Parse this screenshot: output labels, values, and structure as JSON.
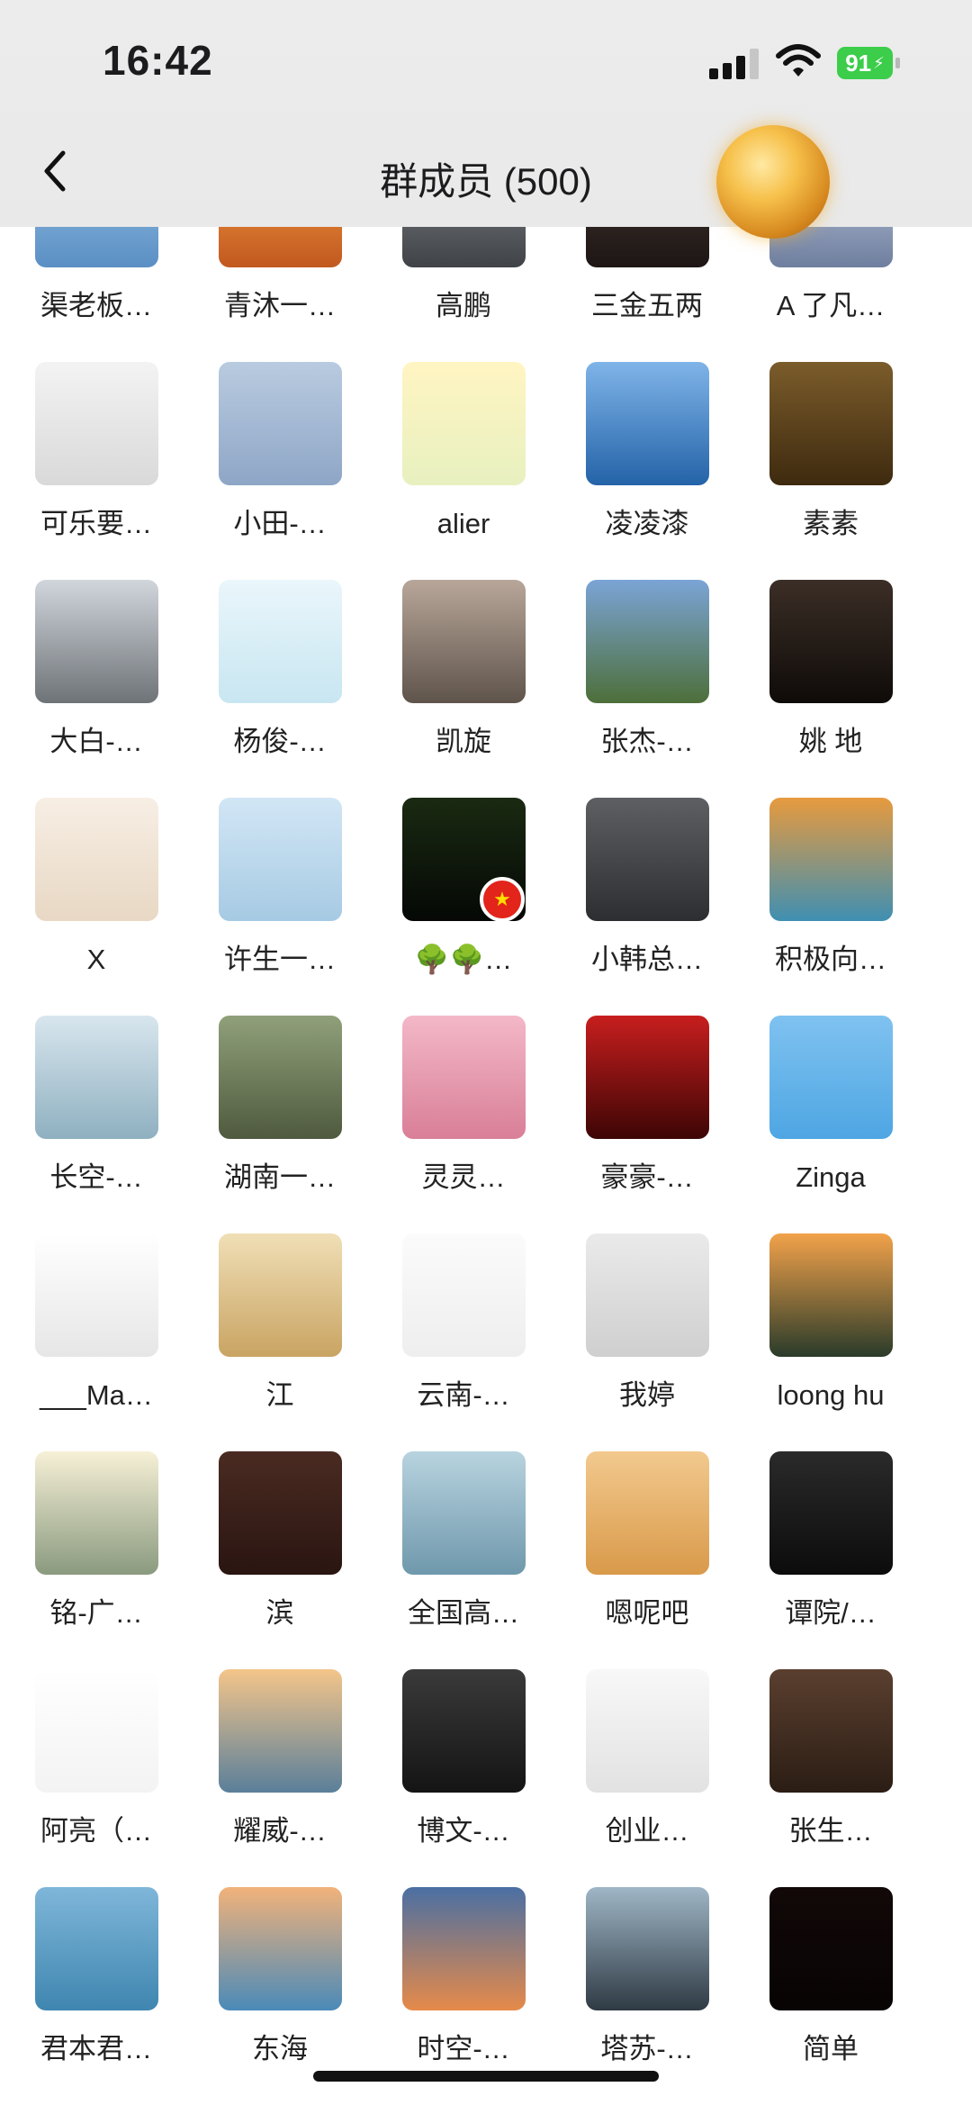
{
  "status_bar": {
    "time": "16:42",
    "battery": "91"
  },
  "header": {
    "title": "群成员 (500)"
  },
  "members": [
    {
      "name": "渠老板…",
      "bg": "linear-gradient(#9fc7e8,#5a8fc4)",
      "icon": "red-heart-icon"
    },
    {
      "name": "青沐一…",
      "bg": "linear-gradient(#f8a94a,#c2581f)",
      "icon": "sunset-person-icon"
    },
    {
      "name": "高鹏",
      "bg": "linear-gradient(#8a8d92,#3f4247)",
      "icon": "landscape-icon"
    },
    {
      "name": "三金五两",
      "bg": "linear-gradient(#4a3a33,#1d1614)",
      "icon": "person-photo-icon"
    },
    {
      "name": "A 了凡…",
      "bg": "linear-gradient(#c9d3e6,#6e7e9e)",
      "icon": "snow-scene-icon"
    },
    {
      "name": "可乐要…",
      "bg": "linear-gradient(#f3f3f3,#d9d9d9)",
      "icon": "man-photo-icon"
    },
    {
      "name": "小田-…",
      "bg": "linear-gradient(#b9cbe0,#8ea6c6)",
      "icon": "cartoon-boy-icon"
    },
    {
      "name": "alier",
      "bg": "linear-gradient(#fff5c2,#e8f0c0)",
      "icon": "cartoon-penguin-icon"
    },
    {
      "name": "凌凌漆",
      "bg": "linear-gradient(#7fb4e8,#2463a8)",
      "icon": "sailboat-icon"
    },
    {
      "name": "素素",
      "bg": "linear-gradient(#7b5c2b,#3e2a0f)",
      "icon": "golden-rose-icon"
    },
    {
      "name": "大白-…",
      "bg": "linear-gradient(#d1d6dc,#6e7378)",
      "icon": "sports-car-icon"
    },
    {
      "name": "杨俊-…",
      "bg": "linear-gradient(#eaf6fb,#c8e6f1)",
      "icon": "cartoon-bear-icon"
    },
    {
      "name": "凯旋",
      "bg": "linear-gradient(#b8a699,#5f544b)",
      "icon": "rock-person-icon"
    },
    {
      "name": "张杰-…",
      "bg": "linear-gradient(#7ba4d6,#4d6f3a)",
      "icon": "waterfall-icon"
    },
    {
      "name": "姚 地",
      "bg": "linear-gradient(#3b2e26,#0f0b09)",
      "icon": "smiling-man-icon"
    },
    {
      "name": "X",
      "bg": "linear-gradient(#f7eee4,#e8d8c4)",
      "icon": "anime-boy-icon"
    },
    {
      "name": "许生一…",
      "bg": "linear-gradient(#d2e6f5,#a6cae3)",
      "icon": "purple-flower-icon"
    },
    {
      "name": "🌳🌳…",
      "bg": "linear-gradient(#1a2a12,#050805)",
      "icon": "night-lake-icon",
      "badge": "china-flag-icon"
    },
    {
      "name": "小韩总…",
      "bg": "linear-gradient(#5d5f63,#2c2e31)",
      "icon": "businessman-icon"
    },
    {
      "name": "积极向…",
      "bg": "linear-gradient(#e79a3e,#3f8fb2)",
      "icon": "autumn-tree-icon"
    },
    {
      "name": "长空-…",
      "bg": "linear-gradient(#d8e6ee,#8fb0c0)",
      "icon": "lake-person-icon"
    },
    {
      "name": "湖南一…",
      "bg": "linear-gradient(#90a07a,#4f5a3e)",
      "icon": "family-photo-icon"
    },
    {
      "name": "灵灵…",
      "bg": "linear-gradient(#f3b8c8,#d97f97)",
      "icon": "anime-girl-icon"
    },
    {
      "name": "豪豪-…",
      "bg": "linear-gradient(#c81e1e,#3d0505)",
      "icon": "black-horse-icon"
    },
    {
      "name": "Zinga",
      "bg": "linear-gradient(#7fc2f0,#4ea6e3)",
      "icon": "cartoon-suit-man-icon"
    },
    {
      "name": "___Ma…",
      "bg": "linear-gradient(#ffffff,#e6e6e6)",
      "icon": "suit-silhouette-icon"
    },
    {
      "name": "江",
      "bg": "linear-gradient(#f0dfb6,#c9a463)",
      "icon": "guardian-gods-icon"
    },
    {
      "name": "云南-…",
      "bg": "linear-gradient(#fbfbfb,#eeeeee)",
      "icon": "fashion-boy-icon"
    },
    {
      "name": "我婷",
      "bg": "linear-gradient(#eaeaea,#cfcfcf)",
      "icon": "cassette-head-icon"
    },
    {
      "name": "loong hu",
      "bg": "linear-gradient(#f2a24a,#2a3b2a)",
      "icon": "sunset-tree-icon"
    },
    {
      "name": "铭-广…",
      "bg": "linear-gradient(#f6f0d6,#8a9a7f)",
      "icon": "sunglasses-buddha-icon"
    },
    {
      "name": "滨",
      "bg": "linear-gradient(#4a2b22,#2a1511)",
      "icon": "illustrated-man-icon"
    },
    {
      "name": "全国高…",
      "bg": "linear-gradient(#b8d3df,#6f98ac)",
      "icon": "beach-person-icon"
    },
    {
      "name": "嗯呢吧",
      "bg": "linear-gradient(#f2c98e,#d99a4a)",
      "icon": "panda-bird-icon"
    },
    {
      "name": "谭院/…",
      "bg": "linear-gradient(#2a2a2a,#0c0c0c)",
      "icon": "car-window-icon"
    },
    {
      "name": "阿亮（…",
      "bg": "linear-gradient(#ffffff,#f3f3f3)",
      "icon": "sketch-boy-logo-icon"
    },
    {
      "name": "耀威-…",
      "bg": "linear-gradient(#f4c58a,#5a7f9a)",
      "icon": "mountain-hiker-icon"
    },
    {
      "name": "博文-…",
      "bg": "linear-gradient(#3a3a3a,#141414)",
      "icon": "motorcycle-icon"
    },
    {
      "name": "创业…",
      "bg": "linear-gradient(#f8f8f8,#e2e2e2)",
      "icon": "laptop-man-icon"
    },
    {
      "name": "张生…",
      "bg": "linear-gradient(#5a3f2f,#2b1d14)",
      "icon": "furniture-logo-icon"
    },
    {
      "name": "君本君…",
      "bg": "linear-gradient(#7fb6d9,#3f86b0)",
      "icon": "woman-beach-icon"
    },
    {
      "name": "东海",
      "bg": "linear-gradient(#f2b27a,#4a8ab8)",
      "icon": "snow-mountain-lake-icon"
    },
    {
      "name": "时空-…",
      "bg": "linear-gradient(#4a6fa3,#e68a4a)",
      "icon": "dusk-person-icon"
    },
    {
      "name": "塔苏-…",
      "bg": "linear-gradient(#9fb6c6,#2f3a44)",
      "icon": "sea-person-icon"
    },
    {
      "name": "简单",
      "bg": "linear-gradient(#120808,#080404)",
      "icon": "dark-avatar-icon"
    }
  ]
}
